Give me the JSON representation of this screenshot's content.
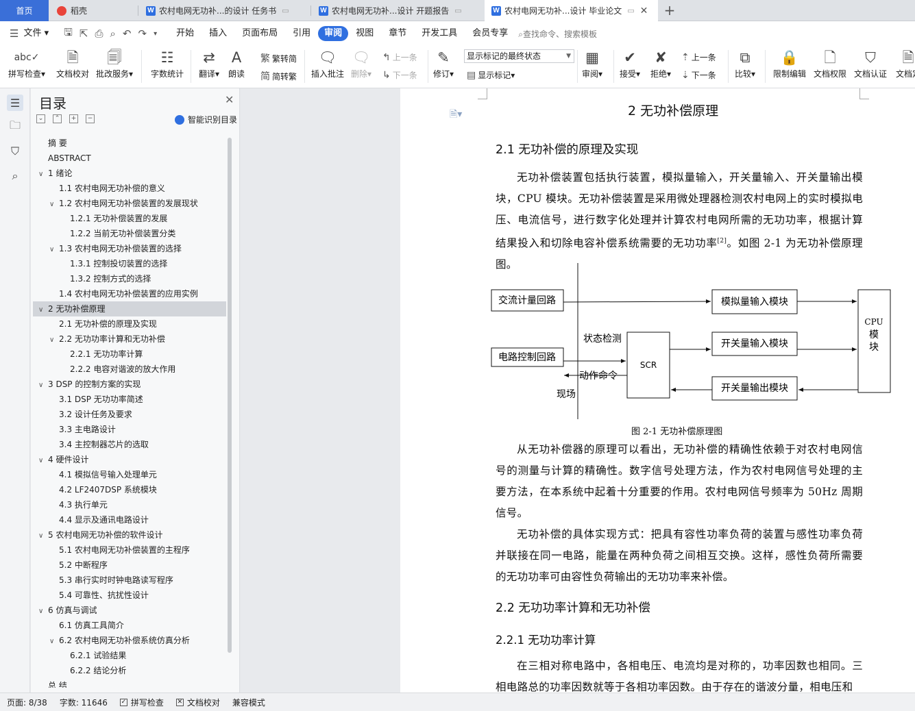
{
  "tabs": {
    "home": "首页",
    "daoke": "稻壳",
    "doc1": "农村电网无功补...的设计 任务书",
    "doc2": "农村电网无功补...设计 开题报告",
    "doc3": "农村电网无功补...设计 毕业论文",
    "new_tab": "+"
  },
  "menu": {
    "file": "文件",
    "items": [
      "开始",
      "插入",
      "页面布局",
      "引用",
      "审阅",
      "视图",
      "章节",
      "开发工具",
      "会员专享"
    ],
    "search_placeholder": "查找命令、搜索模板"
  },
  "ribbon": {
    "spell_check": "拼写检查",
    "doc_proof": "文档校对",
    "annotate_service": "批改服务",
    "word_count": "字数统计",
    "translate": "翻译",
    "read_aloud": "朗读",
    "trad_simp": "繁转简",
    "simp_trad": "简转繁",
    "insert_comment": "插入批注",
    "delete": "删除",
    "prev": "上一条",
    "next": "下一条",
    "track_changes": "修订",
    "markup_select": "显示标记的最终状态",
    "show_markup": "显示标记",
    "review": "审阅",
    "accept": "接受",
    "reject": "拒绝",
    "prev2": "上一条",
    "next2": "下一条",
    "compare": "比较",
    "restrict_edit": "限制编辑",
    "doc_permission": "文档权限",
    "doc_cert": "文档认证",
    "doc_final": "文档定"
  },
  "toc": {
    "title": "目录",
    "smart": "智能识别目录",
    "items": [
      {
        "text": "摘  要",
        "level": 0,
        "caret": ""
      },
      {
        "text": "ABSTRACT",
        "level": 0,
        "caret": ""
      },
      {
        "text": "1 绪论",
        "level": 0,
        "caret": "v"
      },
      {
        "text": "1.1 农村电网无功补偿的意义",
        "level": 1,
        "caret": ""
      },
      {
        "text": "1.2 农村电网无功补偿装置的发展现状",
        "level": 1,
        "caret": "v"
      },
      {
        "text": "1.2.1 无功补偿装置的发展",
        "level": 2,
        "caret": ""
      },
      {
        "text": "1.2.2 当前无功补偿装置分类",
        "level": 2,
        "caret": ""
      },
      {
        "text": "1.3 农村电网无功补偿装置的选择",
        "level": 1,
        "caret": "v"
      },
      {
        "text": "1.3.1 控制投切装置的选择",
        "level": 2,
        "caret": ""
      },
      {
        "text": "1.3.2 控制方式的选择",
        "level": 2,
        "caret": ""
      },
      {
        "text": "1.4 农村电网无功补偿装置的应用实例",
        "level": 1,
        "caret": ""
      },
      {
        "text": "2  无功补偿原理",
        "level": 0,
        "caret": "v",
        "selected": true
      },
      {
        "text": "2.1 无功补偿的原理及实现",
        "level": 1,
        "caret": ""
      },
      {
        "text": "2.2 无功功率计算和无功补偿",
        "level": 1,
        "caret": "v"
      },
      {
        "text": "2.2.1 无功功率计算",
        "level": 2,
        "caret": ""
      },
      {
        "text": "2.2.2 电容对谐波的放大作用",
        "level": 2,
        "caret": ""
      },
      {
        "text": "3 DSP 的控制方案的实现",
        "level": 0,
        "caret": "v"
      },
      {
        "text": "3.1 DSP 无功功率简述",
        "level": 1,
        "caret": ""
      },
      {
        "text": "3.2 设计任务及要求",
        "level": 1,
        "caret": ""
      },
      {
        "text": "3.3 主电路设计",
        "level": 1,
        "caret": ""
      },
      {
        "text": "3.4 主控制器芯片的选取",
        "level": 1,
        "caret": ""
      },
      {
        "text": "4 硬件设计",
        "level": 0,
        "caret": "v"
      },
      {
        "text": "4.1 模拟信号输入处理单元",
        "level": 1,
        "caret": ""
      },
      {
        "text": "4.2 LF2407DSP 系统模块",
        "level": 1,
        "caret": ""
      },
      {
        "text": "4.3 执行单元",
        "level": 1,
        "caret": ""
      },
      {
        "text": "4.4 显示及通讯电路设计",
        "level": 1,
        "caret": ""
      },
      {
        "text": "5 农村电网无功补偿的软件设计",
        "level": 0,
        "caret": "v"
      },
      {
        "text": "5.1 农村电网无功补偿装置的主程序",
        "level": 1,
        "caret": ""
      },
      {
        "text": "5.2 中断程序",
        "level": 1,
        "caret": ""
      },
      {
        "text": "5.3 串行实时时钟电路读写程序",
        "level": 1,
        "caret": ""
      },
      {
        "text": "5.4 可靠性、抗扰性设计",
        "level": 1,
        "caret": ""
      },
      {
        "text": "6 仿真与调试",
        "level": 0,
        "caret": "v"
      },
      {
        "text": "6.1 仿真工具简介",
        "level": 1,
        "caret": ""
      },
      {
        "text": "6.2 农村电网无功补偿系统仿真分析",
        "level": 1,
        "caret": "v"
      },
      {
        "text": "6.2.1 试验结果",
        "level": 2,
        "caret": ""
      },
      {
        "text": "6.2.2 结论分析",
        "level": 2,
        "caret": ""
      },
      {
        "text": "总  结",
        "level": 0,
        "caret": ""
      }
    ]
  },
  "document": {
    "chapter": "2  无功补偿原理",
    "s21": "2.1 无功补偿的原理及实现",
    "p1": "无功补偿装置包括执行装置，模拟量输入，开关量输入、开关量输出模块，CPU 模块。无功补偿装置是采用微处理器检测农村电网上的实时模拟电压、电流信号，进行数字化处理并计算农村电网所需的无功功率，根据计算结果投入和切除电容补偿系统需要的无功功率",
    "p1_ref": "[2]",
    "p1_tail": "。如图 2-1 为无功补偿原理图。",
    "figure": {
      "ac_loop": "交流计量回路",
      "circuit_ctrl": "电路控制回路",
      "analog_in": "模拟量输入模块",
      "switch_in": "开关量输入模块",
      "switch_out": "开关量输出模块",
      "scr": "SCR",
      "cpu1": "CPU",
      "cpu2": "模",
      "cpu3": "块",
      "state_detect": "状态检测",
      "action_cmd": "动作命令",
      "field": "现场"
    },
    "caption": "图 2-1 无功补偿原理图",
    "p2": "从无功补偿器的原理可以看出，无功补偿的精确性依赖于对农村电网信号的测量与计算的精确性。数字信号处理方法，作为农村电网信号处理的主要方法，在本系统中起着十分重要的作用。农村电网信号频率为 50Hz 周期信号。",
    "p3": "无功补偿的具体实现方式：把具有容性功率负荷的装置与感性功率负荷并联接在同一电路，能量在两种负荷之间相互交换。这样，感性负荷所需要的无功功率可由容性负荷输出的无功功率来补偿。",
    "s22": "2.2 无功功率计算和无功补偿",
    "s221": "2.2.1 无功功率计算",
    "p4": "在三相对称电路中，各相电压、电流均是对称的，功率因数也相同。三相电路总的功率因数就等于各相功率因数。由于存在的谐波分量，相电压和"
  },
  "status": {
    "page": "页面: 8/38",
    "words": "字数: 11646",
    "spell": "拼写检查",
    "proof": "文档校对",
    "compat": "兼容模式"
  },
  "colors": {
    "accent": "#2f6fe0",
    "toc_selected": "#d2d5da"
  }
}
